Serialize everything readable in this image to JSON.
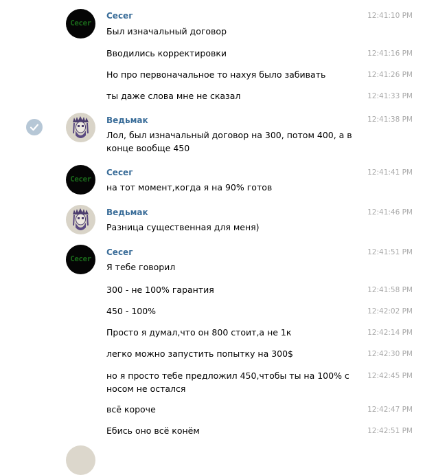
{
  "messages": [
    {
      "author": "Сесег",
      "text": "Был изначальный договор",
      "time": "12:41:10 PM"
    },
    {
      "author": "",
      "text": "Вводились корректировки",
      "time": "12:41:16 PM"
    },
    {
      "author": "",
      "text": "Но про первоначальное то нахуя было забивать",
      "time": "12:41:26 PM"
    },
    {
      "author": "",
      "text": "ты даже слова мне не сказал",
      "time": "12:41:33 PM"
    },
    {
      "author": "Ведьмак",
      "text": "Лол, был изначальный договор на 300, потом 400, а в конце вообще 450",
      "time": "12:41:38 PM"
    },
    {
      "author": "Сесег",
      "text": "на тот момент,когда я на 90% готов",
      "time": "12:41:41 PM"
    },
    {
      "author": "Ведьмак",
      "text": "Разница существенная для меня)",
      "time": "12:41:46 PM"
    },
    {
      "author": "Сесег",
      "text": "Я тебе говорил",
      "time": "12:41:51 PM"
    },
    {
      "author": "",
      "text": "300 - не 100% гарантия",
      "time": "12:41:58 PM"
    },
    {
      "author": "",
      "text": "450 - 100%",
      "time": "12:42:02 PM"
    },
    {
      "author": "",
      "text": "Просто я думал,что он 800 стоит,а не 1к",
      "time": "12:42:14 PM"
    },
    {
      "author": "",
      "text": "легко можно запустить попытку на 300$",
      "time": "12:42:30 PM"
    },
    {
      "author": "",
      "text": "но я просто тебе предложил 450,чтобы ты на 100% с носом не остался",
      "time": "12:42:45 PM"
    },
    {
      "author": "",
      "text": "всё короче",
      "time": "12:42:47 PM"
    },
    {
      "author": "",
      "text": "Ебись оно всё конём",
      "time": "12:42:51 PM"
    }
  ],
  "avatars": {
    "cecer_text": "Cecer"
  },
  "icons": {
    "selected": "check-circle-icon",
    "vedmak_avatar": "native-headdress-skull-icon"
  },
  "colors": {
    "author_name": "#3a6d99",
    "timestamp": "#a9a9a9",
    "check_circle": "#b6c7d6"
  }
}
